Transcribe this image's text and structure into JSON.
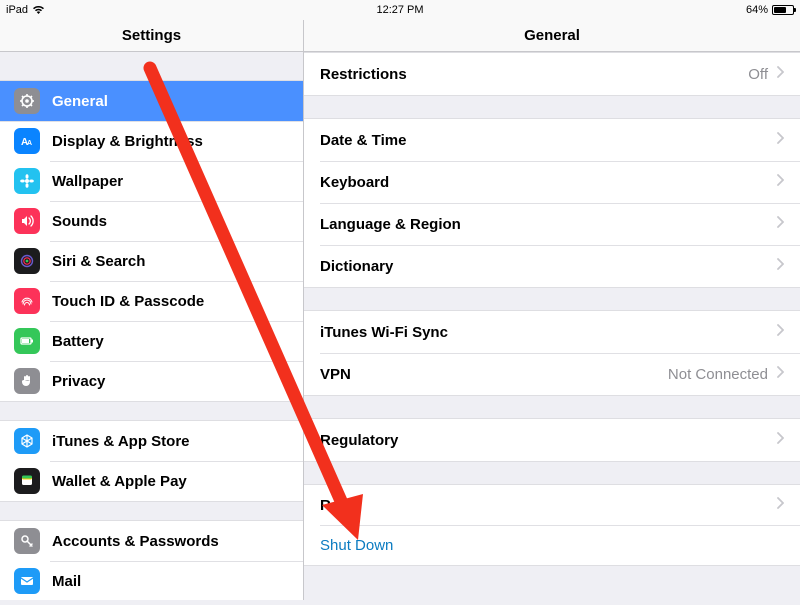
{
  "statusbar": {
    "device": "iPad",
    "time": "12:27 PM",
    "battery_pct": "64%"
  },
  "header": {
    "sidebar_title": "Settings",
    "detail_title": "General"
  },
  "sidebar": {
    "groups": [
      {
        "items": [
          {
            "label": "General"
          },
          {
            "label": "Display & Brightness"
          },
          {
            "label": "Wallpaper"
          },
          {
            "label": "Sounds"
          },
          {
            "label": "Siri & Search"
          },
          {
            "label": "Touch ID & Passcode"
          },
          {
            "label": "Battery"
          },
          {
            "label": "Privacy"
          }
        ]
      },
      {
        "items": [
          {
            "label": "iTunes & App Store"
          },
          {
            "label": "Wallet & Apple Pay"
          }
        ]
      },
      {
        "items": [
          {
            "label": "Accounts & Passwords"
          },
          {
            "label": "Mail"
          }
        ]
      }
    ]
  },
  "detail": {
    "groups": [
      {
        "rows": [
          {
            "label": "Restrictions",
            "value": "Off",
            "chevron": true
          }
        ]
      },
      {
        "rows": [
          {
            "label": "Date & Time",
            "chevron": true
          },
          {
            "label": "Keyboard",
            "chevron": true
          },
          {
            "label": "Language & Region",
            "chevron": true
          },
          {
            "label": "Dictionary",
            "chevron": true
          }
        ]
      },
      {
        "rows": [
          {
            "label": "iTunes Wi-Fi Sync",
            "chevron": true
          },
          {
            "label": "VPN",
            "value": "Not Connected",
            "chevron": true
          }
        ]
      },
      {
        "rows": [
          {
            "label": "Regulatory",
            "chevron": true
          }
        ]
      },
      {
        "rows": [
          {
            "label": "Reset",
            "chevron": true
          },
          {
            "link": "Shut Down"
          }
        ]
      }
    ]
  },
  "annotation": {
    "arrow": "red-arrow"
  }
}
